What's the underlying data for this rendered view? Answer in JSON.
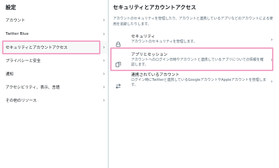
{
  "left": {
    "title": "設定",
    "items": [
      {
        "label": "アカウント"
      },
      {
        "label": "Twitter Blue"
      },
      {
        "label": "セキュリティとアカウントアクセス",
        "active": true
      },
      {
        "label": "プライバシーと安全"
      },
      {
        "label": "通知"
      },
      {
        "label": "アクセシビリティ、表示、言語"
      },
      {
        "label": "その他のリソース"
      }
    ]
  },
  "right": {
    "title": "セキュリティとアカウントアクセス",
    "description": "アカウントのセキュリティを管理したり、アカウントと連携しているアプリなどのアカウントによる使用を追跡したりします。",
    "rows": [
      {
        "icon": "lock-icon",
        "title": "セキュリティ",
        "subtitle": "アカウントのセキュリティを管理します。"
      },
      {
        "icon": "apps-icon",
        "title": "アプリとセッション",
        "subtitle": "アカウントへのログイン日時やアカウントと連携しているアプリについての情報を確認します。"
      },
      {
        "icon": "swap-arrows-icon",
        "title": "連携されているアカウント",
        "subtitle": "ログイン時にTwitterと連携しているGoogleアカウントやAppleアカウントを管理します。"
      }
    ]
  },
  "colors": {
    "highlight": "#f3a6c8",
    "text_primary": "#0f1419",
    "text_secondary": "#536471",
    "active_bg": "#f7f9f9"
  }
}
